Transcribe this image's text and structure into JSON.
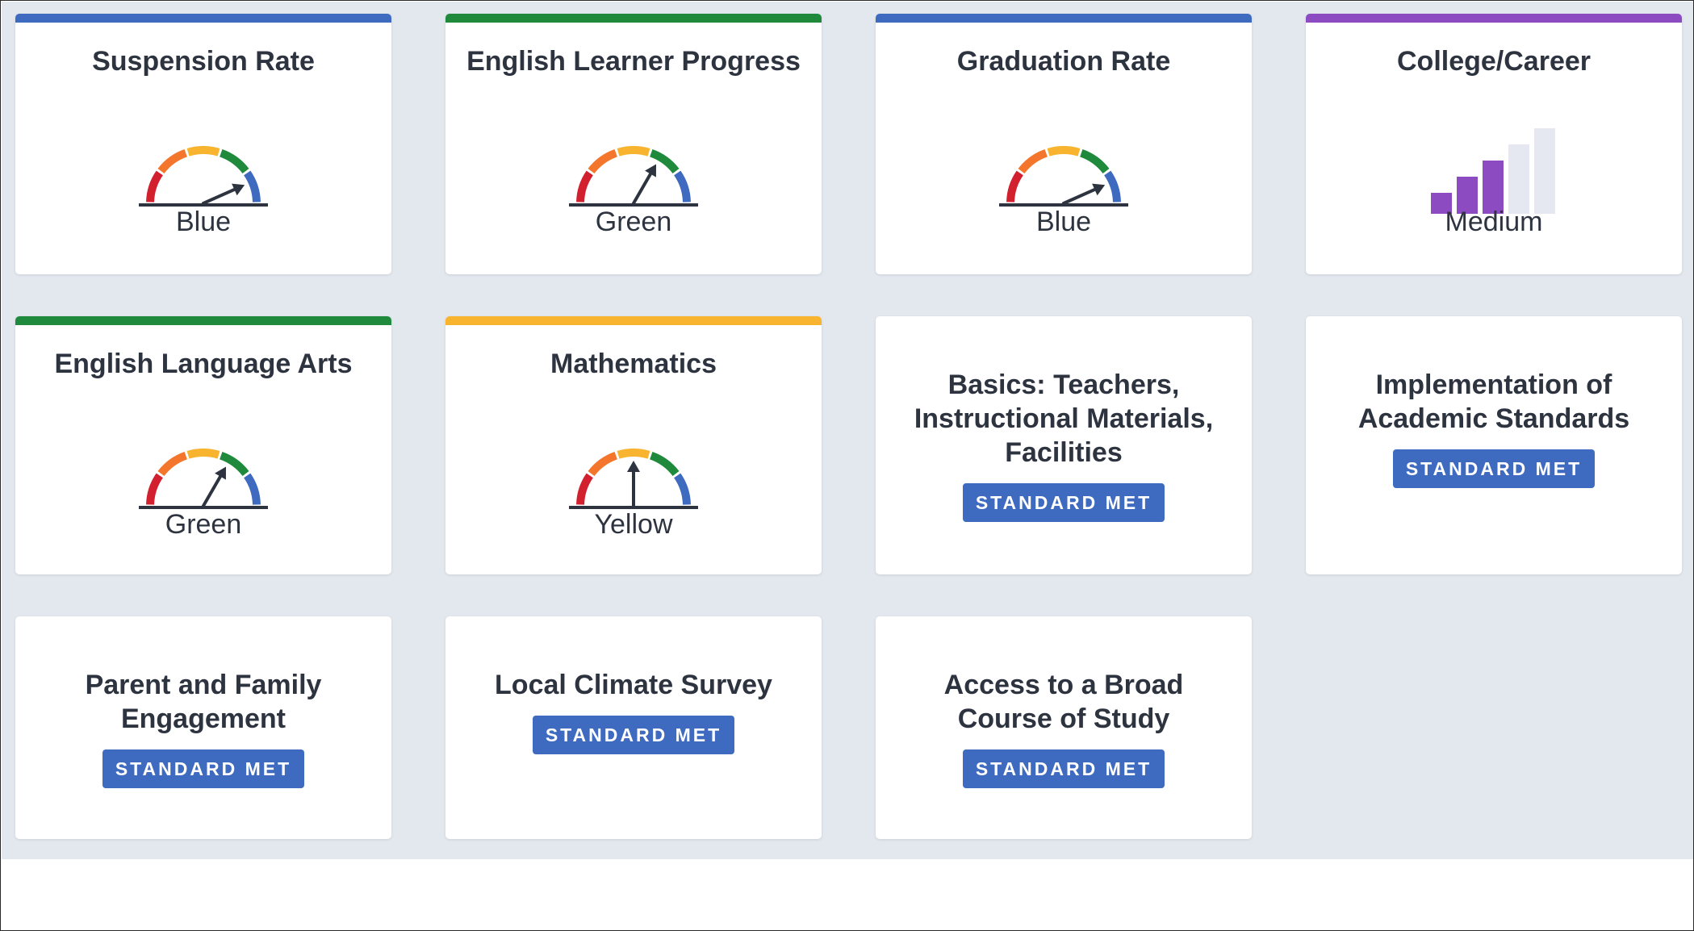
{
  "colors": {
    "blue": "#3e6ac0",
    "green": "#1f8a3b",
    "yellow": "#f8b42f",
    "orange": "#f4762c",
    "red": "#d3202f",
    "purple": "#8c4bc1",
    "badge": "#3e6ac0",
    "page_bg": "#e3e8ef"
  },
  "state_indicators": [
    {
      "title": "Suspension Rate",
      "level": "Blue",
      "accent": "#3e6ac0",
      "needle_level": 5
    },
    {
      "title": "English Learner Progress",
      "level": "Green",
      "accent": "#1f8a3b",
      "needle_level": 4
    },
    {
      "title": "Graduation Rate",
      "level": "Blue",
      "accent": "#3e6ac0",
      "needle_level": 5
    },
    {
      "title": "College/Career",
      "level": "Medium",
      "accent": "#8c4bc1",
      "bar_level": 3,
      "bar_total": 5
    },
    {
      "title": "English Language Arts",
      "level": "Green",
      "accent": "#1f8a3b",
      "needle_level": 4
    },
    {
      "title": "Mathematics",
      "level": "Yellow",
      "accent": "#f8b42f",
      "needle_level": 3
    }
  ],
  "local_indicators": [
    {
      "title": "Basics: Teachers, Instructional Materials, Facilities",
      "status": "STANDARD MET"
    },
    {
      "title": "Implementation of Academic Standards",
      "status": "STANDARD MET"
    },
    {
      "title": "Parent and Family Engagement",
      "status": "STANDARD MET"
    },
    {
      "title": "Local Climate Survey",
      "status": "STANDARD MET"
    },
    {
      "title": "Access to a Broad Course of Study",
      "status": "STANDARD MET"
    }
  ]
}
